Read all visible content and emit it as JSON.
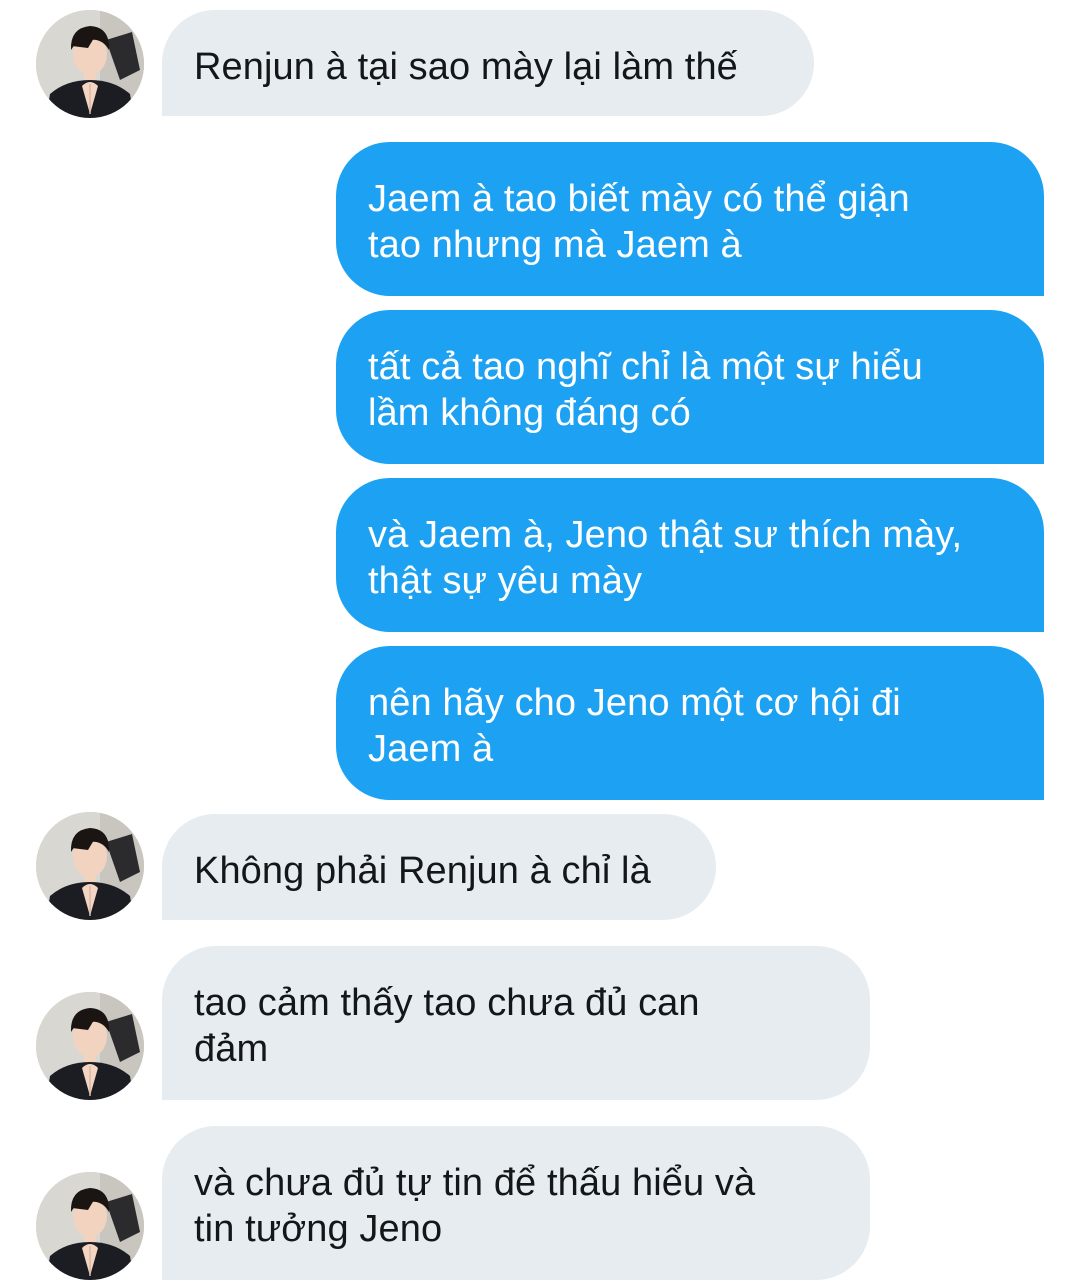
{
  "conversation": {
    "messages": [
      {
        "direction": "incoming",
        "text": "Renjun à tại sao mày lại làm thế"
      },
      {
        "direction": "outgoing",
        "text": "Jaem à tao biết mày có thể giận\ntao nhưng mà Jaem à"
      },
      {
        "direction": "outgoing",
        "text": "tất cả tao nghĩ chỉ là một sự hiểu\nlầm không đáng có"
      },
      {
        "direction": "outgoing",
        "text": "và Jaem à, Jeno thật sư thích mày,\nthật sự yêu mày"
      },
      {
        "direction": "outgoing",
        "text": "nên hãy cho Jeno một cơ hội đi\nJaem à"
      },
      {
        "direction": "incoming",
        "text": "Không phải Renjun à chỉ là"
      },
      {
        "direction": "incoming",
        "text": "tao cảm thấy tao chưa đủ can\nđảm"
      },
      {
        "direction": "incoming",
        "text": "và chưa đủ tự tin để thấu hiểu và\ntin tưởng Jeno"
      }
    ]
  },
  "icons": {
    "avatar": "contact-avatar-person"
  },
  "colors": {
    "incoming_bubble": "#e6ecf0",
    "outgoing_bubble": "#1da1f2",
    "incoming_text": "#14171a",
    "outgoing_text": "#ffffff"
  }
}
